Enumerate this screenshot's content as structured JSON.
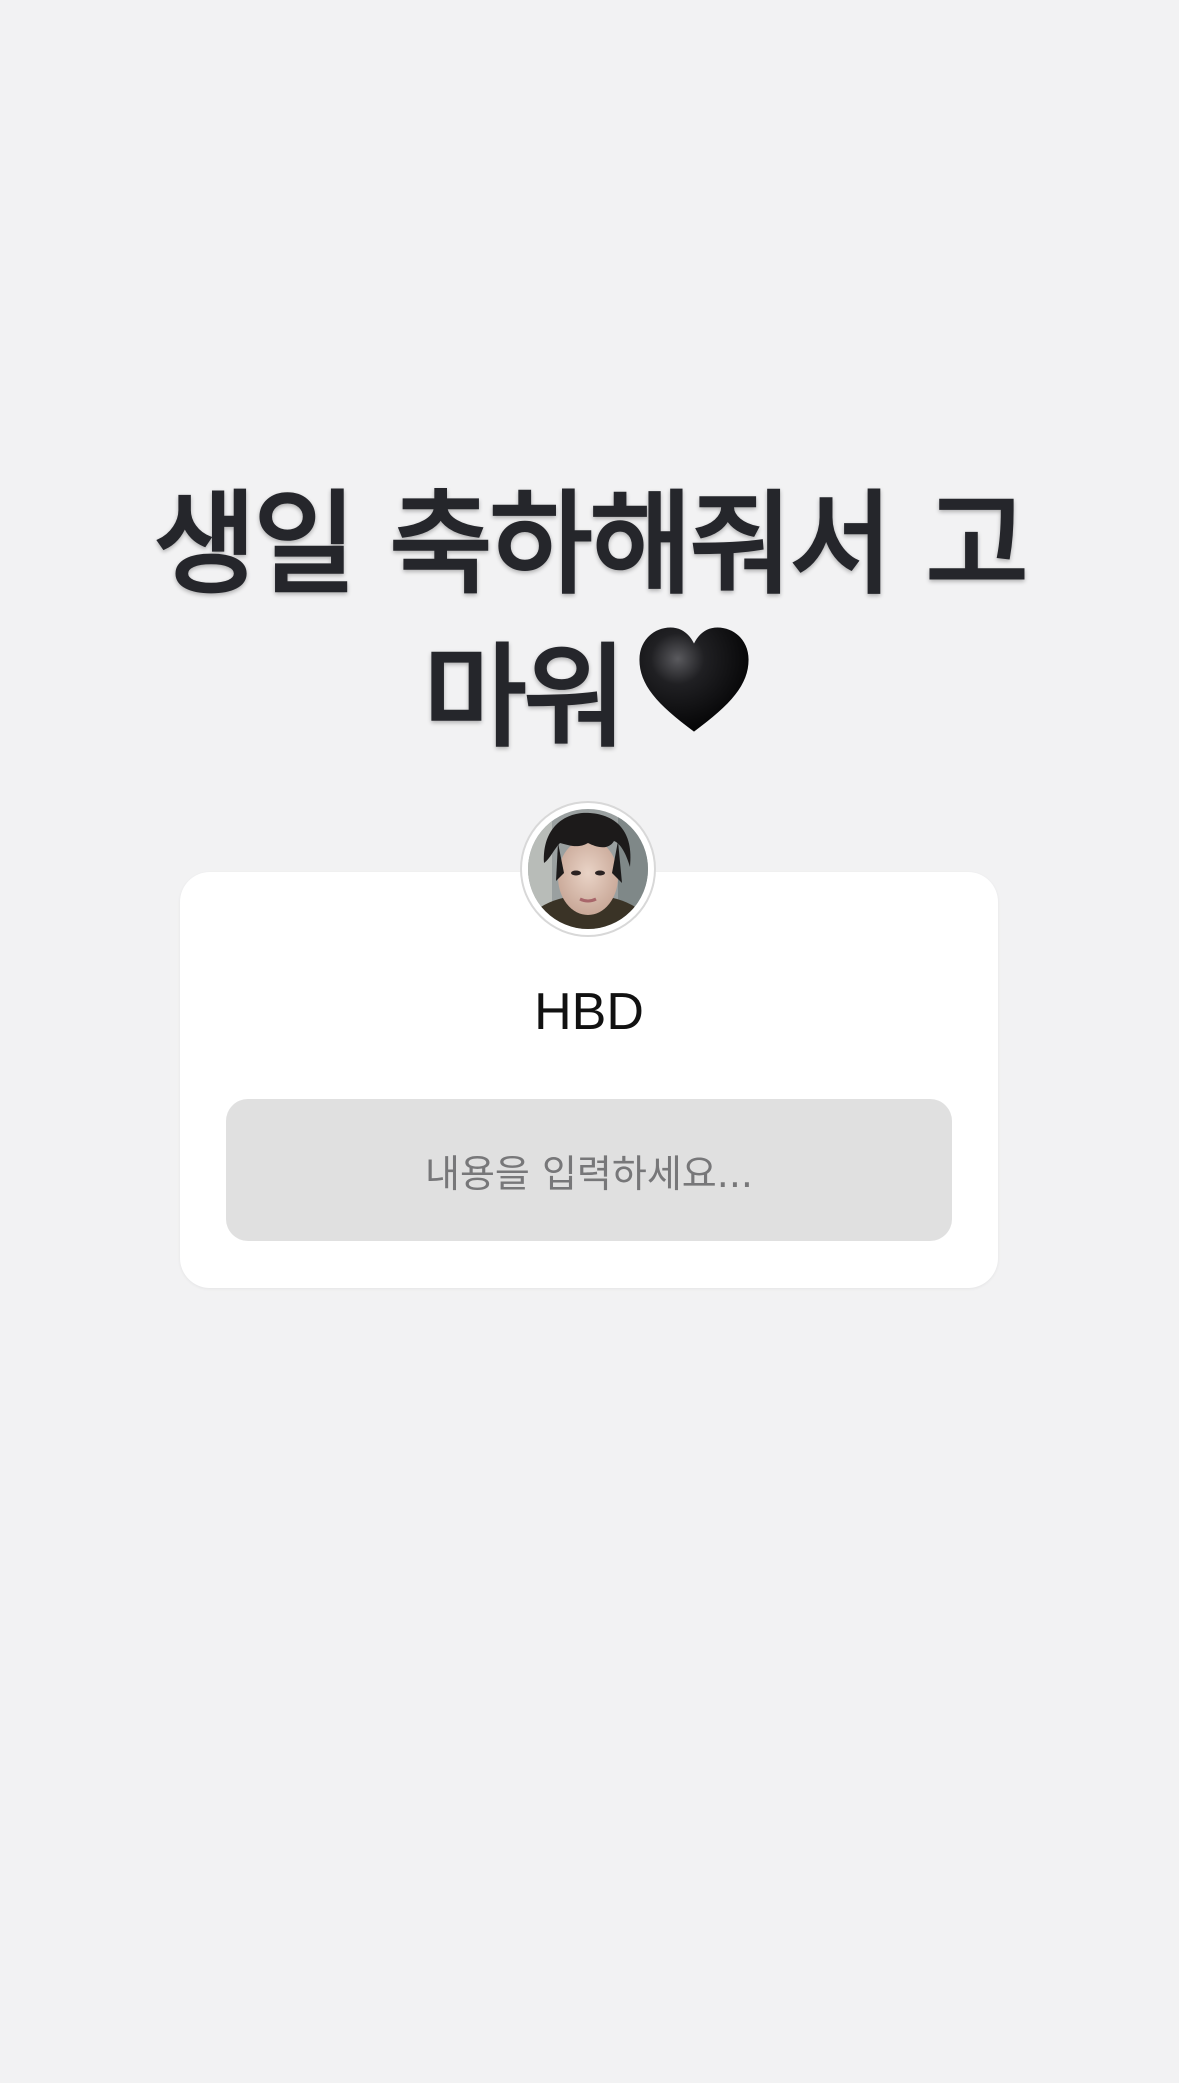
{
  "headline": {
    "line1": "생일 축하해줘서 고",
    "line2": "마워",
    "emoji_icon": "black-heart-icon"
  },
  "question_card": {
    "title": "HBD",
    "input_placeholder": "내용을 입력하세요...",
    "avatar_icon": "profile-photo"
  },
  "colors": {
    "background": "#f2f2f3",
    "card": "#ffffff",
    "input": "#e0e0e0",
    "headline_text": "#25262b",
    "placeholder_text": "#777779"
  }
}
